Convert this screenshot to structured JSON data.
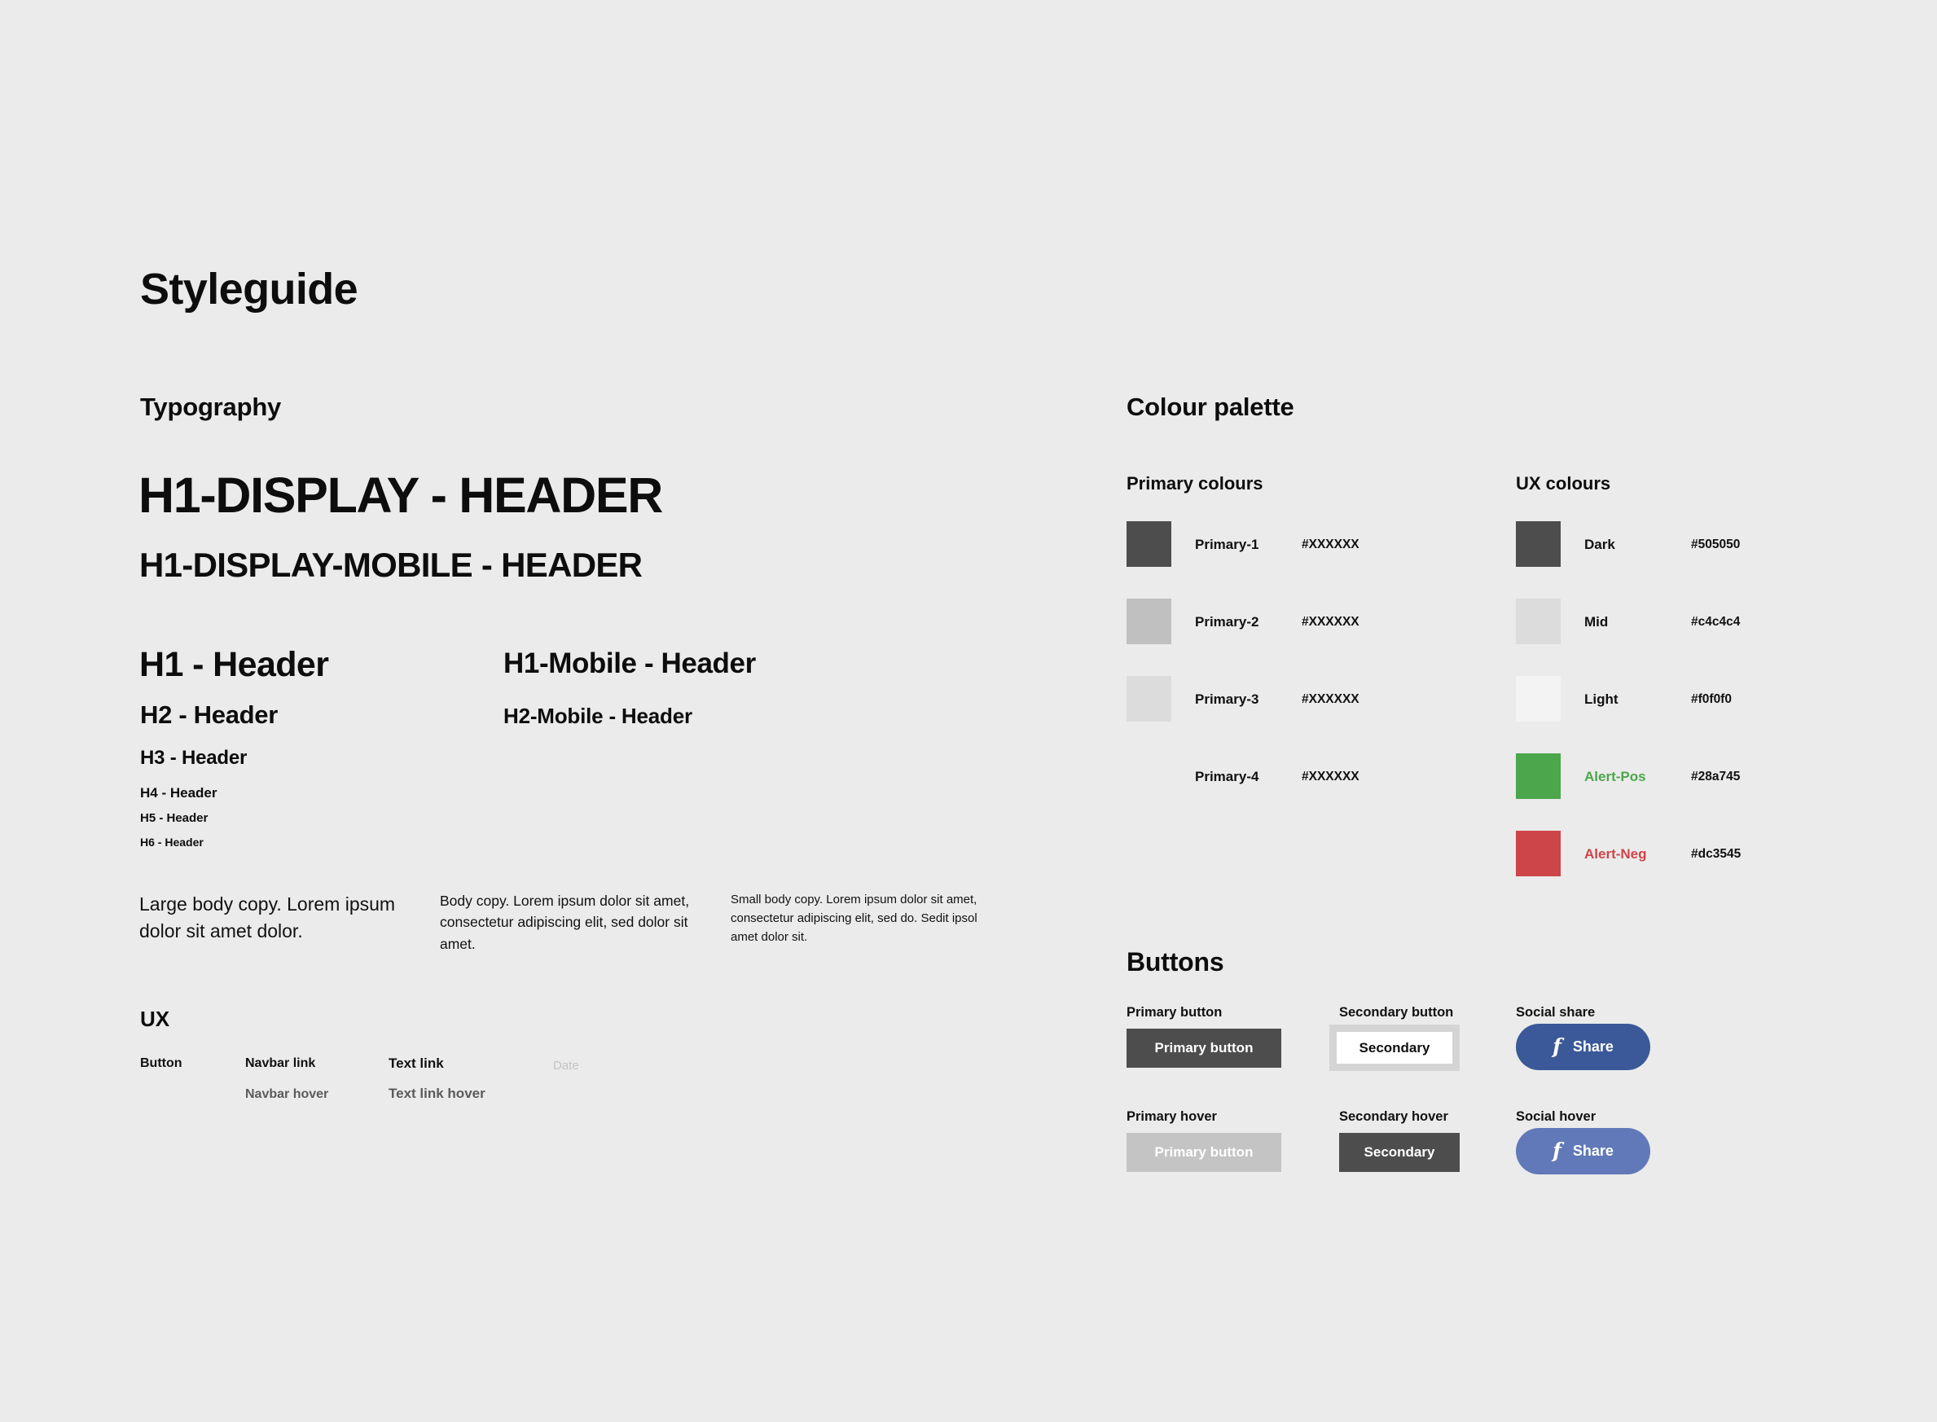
{
  "page": {
    "title": "Styleguide",
    "background": "#ebebeb"
  },
  "typography": {
    "heading": "Typography",
    "specimens": {
      "h1_display": "H1-DISPLAY - HEADER",
      "h1_display_mobile": "H1-DISPLAY-MOBILE - HEADER",
      "h1_header": "H1 - Header",
      "h2_header": "H2 - Header",
      "h3_header": "H3 - Header",
      "h4_header": "H4 - Header",
      "h5_header": "H5 - Header",
      "h6_header": "H6 - Header",
      "h1_mobile_header": "H1-Mobile - Header",
      "h2_mobile_header": "H2-Mobile - Header"
    },
    "body_copy": {
      "large": "Large body copy. Lorem ipsum dolor sit amet dolor.",
      "regular": "Body copy. Lorem ipsum dolor sit amet, consectetur adipiscing elit, sed dolor sit amet.",
      "small": "Small body copy. Lorem ipsum dolor sit amet, consectetur adipiscing elit, sed do. Sedit ipsol amet dolor sit."
    }
  },
  "ux": {
    "heading": "UX",
    "items": {
      "button": "Button",
      "navbar_link": "Navbar link",
      "navbar_hover": "Navbar hover",
      "text_link": "Text link",
      "text_link_hover": "Text link hover",
      "date": "Date"
    },
    "colors": {
      "hover_text": "#5b5b5b",
      "date_text": "#c4c4c4"
    }
  },
  "colour_palette": {
    "heading": "Colour palette",
    "primary": {
      "heading": "Primary colours",
      "rows": [
        {
          "name": "Primary-1",
          "hex_label": "#XXXXXX",
          "swatch": "#4d4d4d",
          "has_swatch": true
        },
        {
          "name": "Primary-2",
          "hex_label": "#XXXXXX",
          "swatch": "#c0c0c0",
          "has_swatch": true
        },
        {
          "name": "Primary-3",
          "hex_label": "#XXXXXX",
          "swatch": "#dcdcdc",
          "has_swatch": true
        },
        {
          "name": "Primary-4",
          "hex_label": "#XXXXXX",
          "swatch": "#ebebeb",
          "has_swatch": false
        }
      ]
    },
    "ux_colours": {
      "heading": "UX colours",
      "rows": [
        {
          "name": "Dark",
          "hex_label": "#505050",
          "swatch": "#4d4d4d",
          "name_color": "#111111",
          "has_swatch": true
        },
        {
          "name": "Mid",
          "hex_label": "#c4c4c4",
          "swatch": "#dcdcdc",
          "name_color": "#111111",
          "has_swatch": true
        },
        {
          "name": "Light",
          "hex_label": "#f0f0f0",
          "swatch": "#f3f3f3",
          "name_color": "#111111",
          "has_swatch": true
        },
        {
          "name": "Alert-Pos",
          "hex_label": "#28a745",
          "swatch": "#4ca64c",
          "name_color": "#4ca64c",
          "has_swatch": true
        },
        {
          "name": "Alert-Neg",
          "hex_label": "#dc3545",
          "swatch": "#cd4449",
          "name_color": "#cd4449",
          "has_swatch": true
        }
      ]
    }
  },
  "buttons": {
    "heading": "Buttons",
    "primary_label": "Primary button",
    "primary_text": "Primary button",
    "primary_hover_label": "Primary hover",
    "primary_hover_text": "Primary button",
    "secondary_label": "Secondary button",
    "secondary_text": "Secondary",
    "secondary_hover_label": "Secondary hover",
    "secondary_hover_text": "Secondary",
    "social_share_label": "Social share",
    "social_share_text": "Share",
    "social_hover_label": "Social hover",
    "social_hover_text": "Share",
    "facebook_glyph": "f",
    "colors": {
      "primary_bg": "#4d4d4d",
      "primary_hover_bg": "#c4c4c4",
      "secondary_bg": "#ffffff",
      "secondary_border": "#d4d4d4",
      "secondary_hover_bg": "#4d4d4d",
      "social_bg": "#3b5998",
      "social_hover_bg": "#6179b8"
    }
  }
}
